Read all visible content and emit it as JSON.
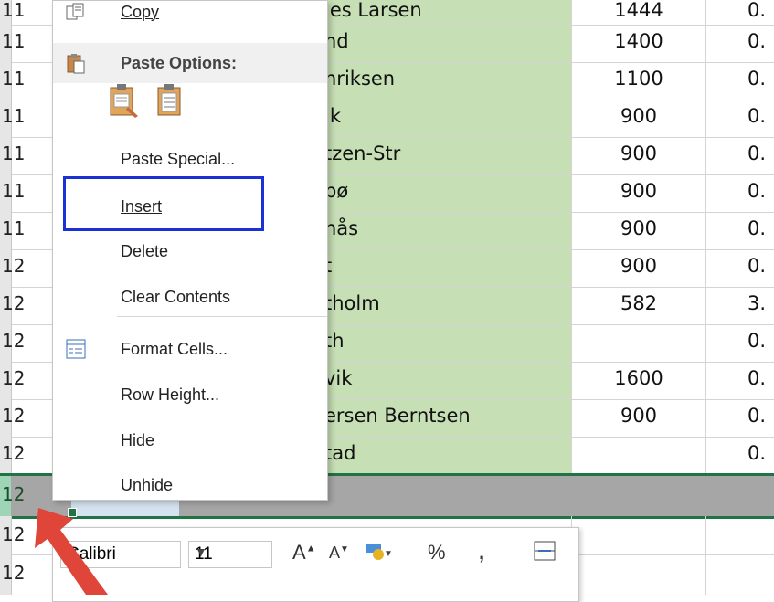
{
  "sheet": {
    "rows": [
      {
        "hdr": "11",
        "name": "ies Larsen",
        "num": "1444",
        "dec": "0."
      },
      {
        "hdr": "11",
        "name": "nd",
        "num": "1400",
        "dec": "0."
      },
      {
        "hdr": "11",
        "name": "nriksen",
        "num": "1100",
        "dec": "0."
      },
      {
        "hdr": "11",
        "name": "ik",
        "num": "900",
        "dec": "0."
      },
      {
        "hdr": "11",
        "name": "tzen-Str",
        "num": "900",
        "dec": "0."
      },
      {
        "hdr": "11",
        "name": "bø",
        "num": "900",
        "dec": "0."
      },
      {
        "hdr": "11",
        "name": "nås",
        "num": "900",
        "dec": "0."
      },
      {
        "hdr": "12",
        "name": "t",
        "num": "900",
        "dec": "0."
      },
      {
        "hdr": "12",
        "name": "tholm",
        "num": "582",
        "dec": "3."
      },
      {
        "hdr": "12",
        "name": "th",
        "num": "",
        "dec": "0."
      },
      {
        "hdr": "12",
        "name": "vik",
        "num": "1600",
        "dec": "0."
      },
      {
        "hdr": "12",
        "name": "ersen Berntsen",
        "num": "900",
        "dec": "0."
      },
      {
        "hdr": "12",
        "name": "tad",
        "num": "",
        "dec": "0."
      }
    ],
    "selected_row_hdr": "12",
    "after_rows": [
      {
        "hdr": "12"
      },
      {
        "hdr": "12"
      }
    ]
  },
  "context_menu": {
    "copy": "Copy",
    "paste_options": "Paste Options:",
    "paste_special": "Paste Special...",
    "insert": "Insert",
    "delete": "Delete",
    "clear_contents": "Clear Contents",
    "format_cells": "Format Cells...",
    "row_height": "Row Height...",
    "hide": "Hide",
    "unhide": "Unhide"
  },
  "mini_toolbar": {
    "font": "Calibri",
    "size": "11",
    "percent": "%",
    "comma": ","
  },
  "colors": {
    "highlight_box": "#1a31d6",
    "excel_green": "#217346",
    "column_fill": "#c6dfb4",
    "arrow": "#e0453a"
  }
}
